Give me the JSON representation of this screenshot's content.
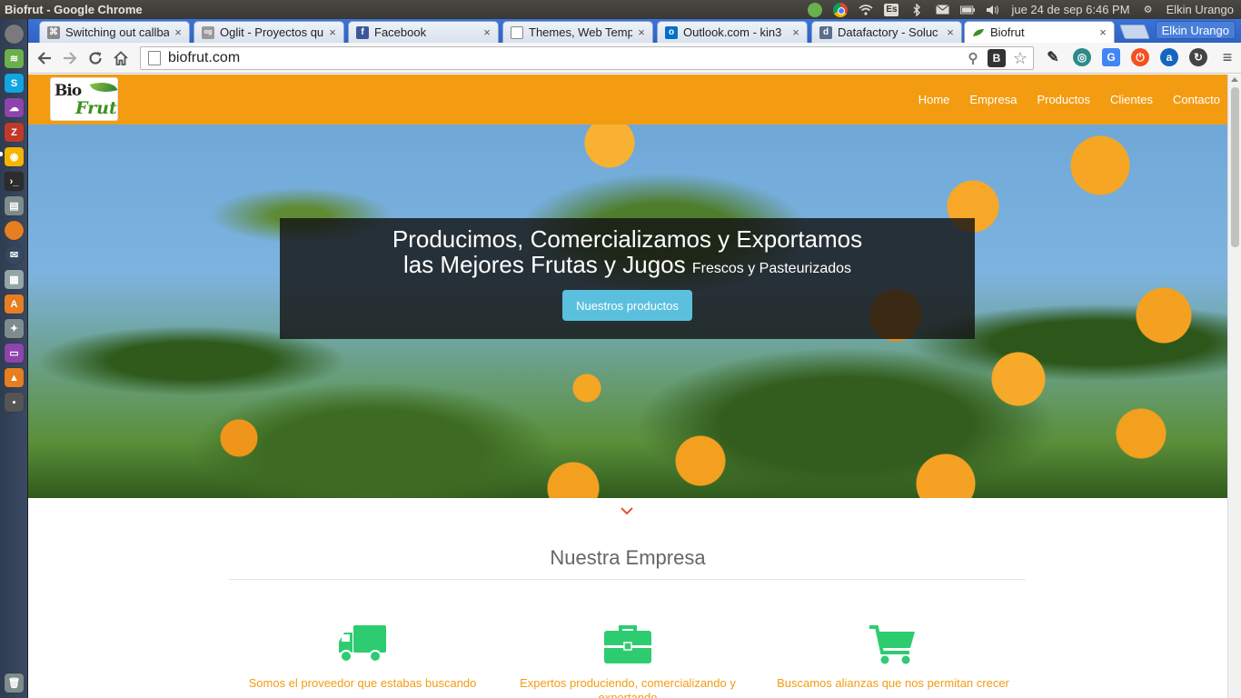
{
  "os": {
    "window_title": "Biofrut - Google Chrome",
    "keyboard_layout": "Es",
    "datetime": "jue 24 de sep  6:46 PM",
    "user": "Elkin Urango"
  },
  "browser": {
    "profile": "Elkin Urango",
    "url": "biofrut.com",
    "tabs": [
      {
        "title": "Switching out callba",
        "favicon": "link-icon"
      },
      {
        "title": "Oglit - Proyectos qu",
        "favicon": "oglit-icon"
      },
      {
        "title": "Facebook",
        "favicon": "facebook-icon"
      },
      {
        "title": "Themes, Web Temp",
        "favicon": "page-icon"
      },
      {
        "title": "Outlook.com - kin3",
        "favicon": "outlook-icon"
      },
      {
        "title": "Datafactory - Soluc",
        "favicon": "datafactory-icon"
      },
      {
        "title": "Biofrut",
        "favicon": "biofrut-leaf-icon",
        "active": true
      }
    ]
  },
  "site": {
    "logo_top": "Bio",
    "logo_bottom": "Frut",
    "nav": [
      "Home",
      "Empresa",
      "Productos",
      "Clientes",
      "Contacto"
    ],
    "hero": {
      "line1": "Producimos, Comercializamos y Exportamos",
      "line2_main": "las Mejores Frutas y Jugos",
      "line2_small": "Frescos y Pasteurizados",
      "button": "Nuestros productos"
    },
    "section_title": "Nuestra Empresa",
    "features": [
      {
        "icon": "truck-icon",
        "text": "Somos el proveedor que estabas buscando"
      },
      {
        "icon": "briefcase-icon",
        "text": "Expertos produciendo, comercializando y exportando"
      },
      {
        "icon": "shopping-cart-icon",
        "text": "Buscamos alianzas que nos permitan crecer"
      }
    ]
  },
  "colors": {
    "nav_orange": "#f39c12",
    "button_blue": "#5bc0de",
    "feature_green": "#2ecc71",
    "feature_text": "#f39c12"
  }
}
